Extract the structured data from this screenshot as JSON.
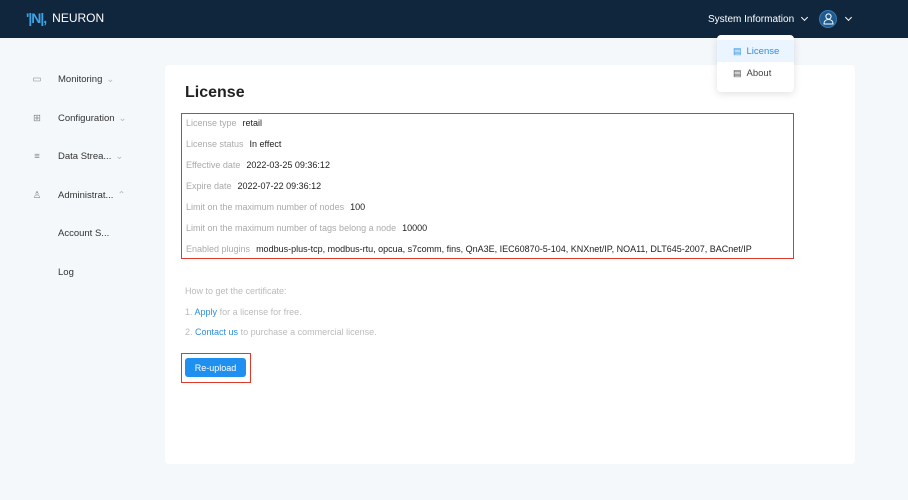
{
  "header": {
    "app_name": "NEURON",
    "system_info": "System Information"
  },
  "sidebar": {
    "items": [
      {
        "label": "Monitoring",
        "icon": "monitor-icon"
      },
      {
        "label": "Configuration",
        "icon": "config-icon"
      },
      {
        "label": "Data Strea...",
        "icon": "data-stream-icon"
      },
      {
        "label": "Administrat...",
        "icon": "user-icon"
      },
      {
        "label": "Account S..."
      },
      {
        "label": "Log"
      }
    ]
  },
  "dropdown": {
    "items": [
      {
        "label": "License"
      },
      {
        "label": "About"
      }
    ]
  },
  "main": {
    "title": "License",
    "fields": [
      {
        "label": "License type",
        "value": "retail"
      },
      {
        "label": "License status",
        "value": "In effect"
      },
      {
        "label": "Effective date",
        "value": "2022-03-25 09:36:12"
      },
      {
        "label": "Expire date",
        "value": "2022-07-22 09:36:12"
      },
      {
        "label": "Limit on the maximum number of nodes",
        "value": "100"
      },
      {
        "label": "Limit on the maximum number of tags belong a node",
        "value": "10000"
      },
      {
        "label": "Enabled plugins",
        "value": "modbus-plus-tcp, modbus-rtu, opcua, s7comm, fins, QnA3E, IEC60870-5-104, KNXnet/IP, NOA11, DLT645-2007, BACnet/IP"
      }
    ],
    "help": {
      "heading": "How to get the certificate:",
      "step1_prefix": "1.",
      "step1_link": "Apply",
      "step1_text": "for a license for free.",
      "step2_prefix": "2.",
      "step2_link": "Contact us",
      "step2_text": "to purchase a commercial license."
    },
    "reupload": "Re-upload"
  }
}
